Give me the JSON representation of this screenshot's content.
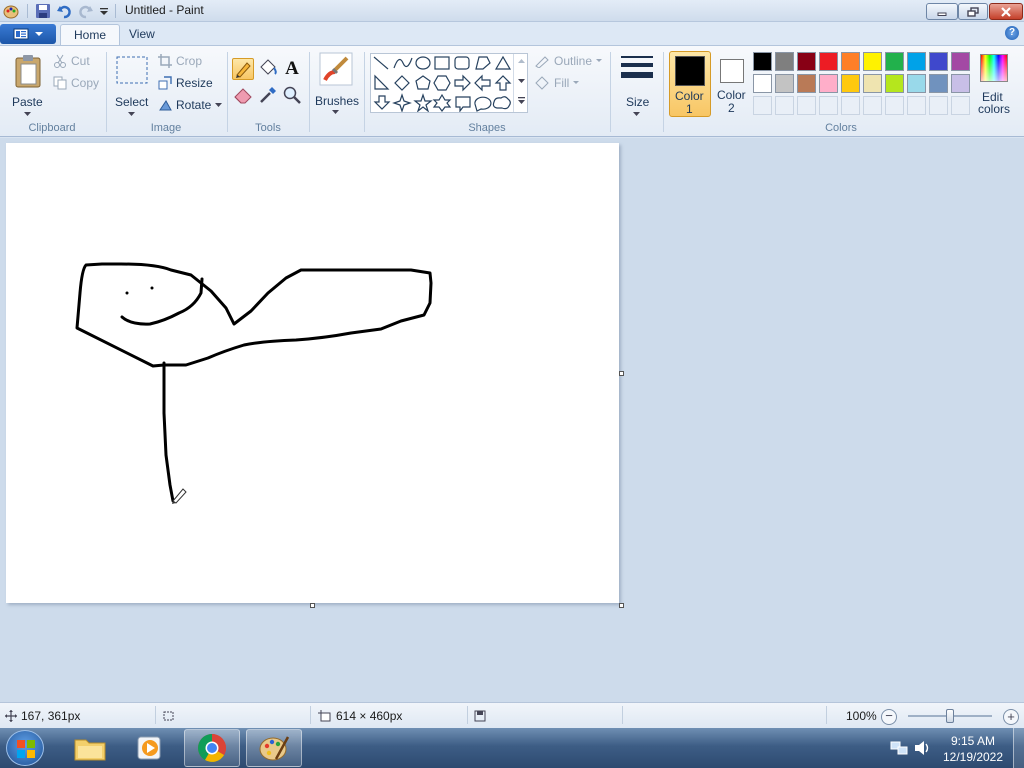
{
  "window": {
    "title": "Untitled - Paint"
  },
  "tabs": [
    {
      "label": "Home"
    },
    {
      "label": "View"
    }
  ],
  "ribbon": {
    "clipboard": {
      "group": "Clipboard",
      "paste": "Paste",
      "cut": "Cut",
      "copy": "Copy"
    },
    "image": {
      "group": "Image",
      "select": "Select",
      "crop": "Crop",
      "resize": "Resize",
      "rotate": "Rotate"
    },
    "tools": {
      "group": "Tools",
      "text_tool": "A"
    },
    "brushes": {
      "label": "Brushes"
    },
    "shapes": {
      "group": "Shapes",
      "outline": "Outline",
      "fill": "Fill"
    },
    "size": {
      "label": "Size"
    },
    "colors": {
      "group": "Colors",
      "color1_line1": "Color",
      "color1_line2": "1",
      "color2_line1": "Color",
      "color2_line2": "2",
      "color1": "#000000",
      "color2": "#ffffff",
      "edit_line1": "Edit",
      "edit_line2": "colors",
      "palette_row1": [
        "#000000",
        "#7f7f7f",
        "#880015",
        "#ed1c24",
        "#ff7f27",
        "#fff200",
        "#22b14c",
        "#00a2e8",
        "#3f48cc",
        "#a349a4"
      ],
      "palette_row2": [
        "#ffffff",
        "#c3c3c3",
        "#b97a57",
        "#ffaec9",
        "#ffc90e",
        "#efe4b0",
        "#b5e61d",
        "#99d9ea",
        "#7092be",
        "#c8bfe7"
      ]
    }
  },
  "statusbar": {
    "cursor_pos": "167, 361px",
    "canvas_size": "614 × 460px",
    "zoom": "100%",
    "zoom_level_fraction": 0.5
  },
  "taskbar": {
    "time": "9:15 AM",
    "date": "12/19/2022"
  }
}
